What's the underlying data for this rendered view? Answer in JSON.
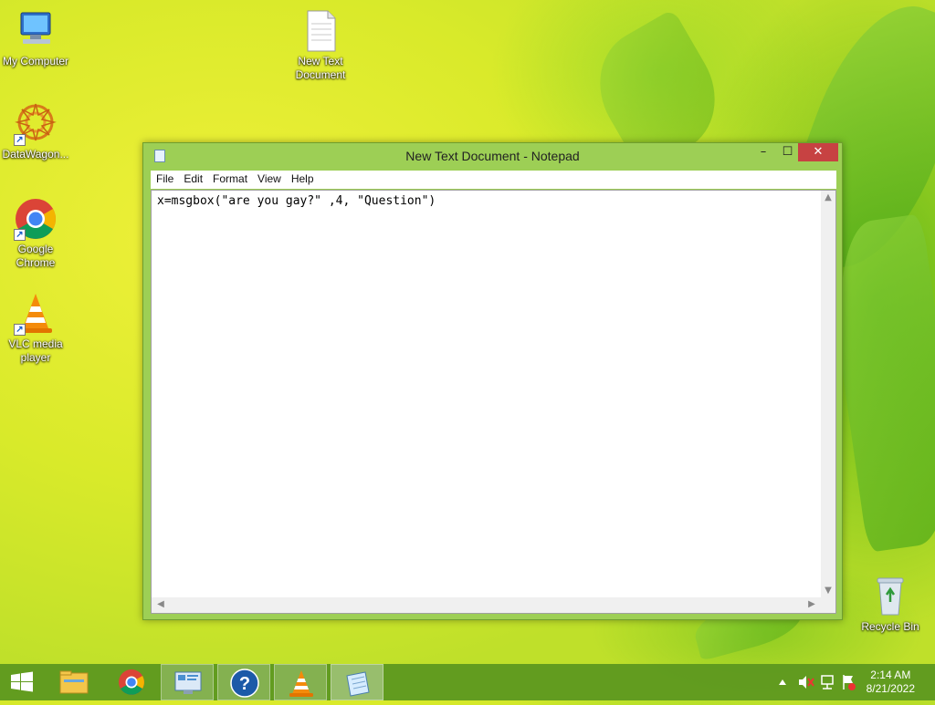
{
  "desktop": {
    "icons": [
      {
        "label": "My Computer"
      },
      {
        "label": "DataWagon..."
      },
      {
        "label": "Google Chrome"
      },
      {
        "label": "VLC media player"
      },
      {
        "label": "New Text Document"
      },
      {
        "label": "Recycle Bin"
      }
    ]
  },
  "window": {
    "title": "New Text Document - Notepad",
    "min_glyph": "–",
    "max_glyph": "☐",
    "close_glyph": "✕",
    "menu": [
      "File",
      "Edit",
      "Format",
      "View",
      "Help"
    ],
    "content": "x=msgbox(\"are you gay?\" ,4, \"Question\")"
  },
  "taskbar": {
    "apps": [
      "start-icon",
      "file-explorer-icon",
      "chrome-icon",
      "control-panel-icon",
      "help-icon",
      "vlc-icon",
      "notepad-icon"
    ],
    "clock_time": "2:14 AM",
    "clock_date": "8/21/2022"
  }
}
